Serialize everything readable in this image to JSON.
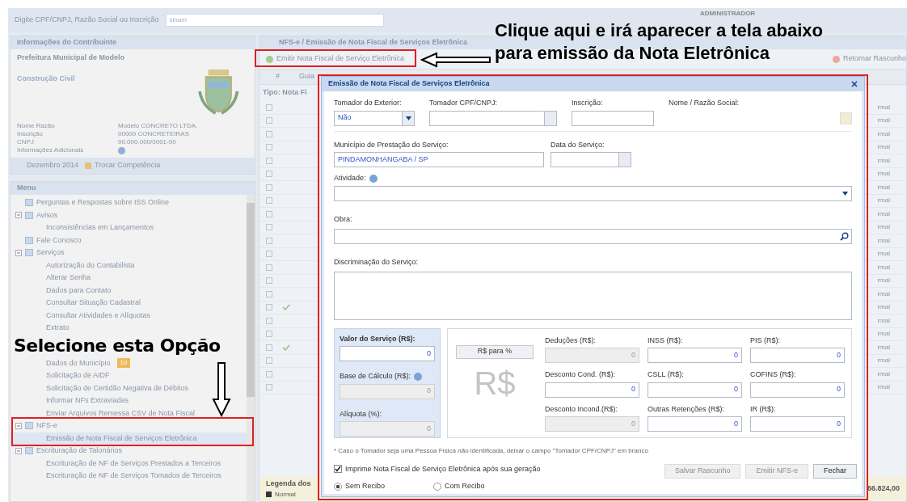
{
  "search": {
    "label": "Digite CPF/CNPJ, Razão Social ou Inscrição",
    "value": "sinam"
  },
  "user": "ADMINISTRADOR",
  "info_panel": {
    "title": "Informações do Contribuinte",
    "org": "Prefeitura Municipal de Modelo",
    "activity": "Construção Civil",
    "fields": [
      {
        "label": "Nome Razão",
        "value": "Modelo CONCRETO LTDA.",
        "kind": "text"
      },
      {
        "label": "Inscrição",
        "value": "00000 CONCRETEIRAS",
        "kind": "text"
      },
      {
        "label": "CNPJ",
        "value": "00.000.000/0001-00",
        "kind": "text"
      },
      {
        "label": "Informações Adicionais",
        "kind": "icon"
      }
    ],
    "period": "Dezembro 2014",
    "change_button": "Trocar Competência"
  },
  "menu": {
    "title": "Menu",
    "items": [
      {
        "kind": "item",
        "label": "Perguntas e Respostas sobre ISS Online",
        "selected": false
      },
      {
        "kind": "item",
        "label": "Avisos",
        "expanded": true,
        "selected": false,
        "children": [
          {
            "kind": "item",
            "label": "Inconsistências em Lançamentos",
            "selected": false
          }
        ]
      },
      {
        "kind": "item",
        "label": "Fale Conosco",
        "selected": false
      },
      {
        "kind": "item",
        "label": "Serviços",
        "expanded": true,
        "selected": false,
        "children": [
          {
            "kind": "item",
            "label": "Autorização do Contabilista",
            "selected": false
          },
          {
            "kind": "item",
            "label": "Alterar Senha",
            "selected": false
          },
          {
            "kind": "item",
            "label": "Dados para Contato",
            "selected": false
          },
          {
            "kind": "item",
            "label": "Consultar Situação Cadastral",
            "selected": false
          },
          {
            "kind": "item",
            "label": "Consultar Atividades e Alíquotas",
            "selected": false
          },
          {
            "kind": "item",
            "label": "Extrato",
            "selected": false
          },
          {
            "kind": "callout",
            "label": "Selecione esta Opção"
          },
          {
            "kind": "item",
            "label": "Dados do Município",
            "badge": "10",
            "selected": false
          },
          {
            "kind": "item",
            "label": "Solicitação de AIDF",
            "selected": false
          },
          {
            "kind": "item",
            "label": "Solicitação de Certidão Negativa de Débitos",
            "selected": false
          },
          {
            "kind": "item",
            "label": "Informar NFs Extraviadas",
            "selected": false
          },
          {
            "kind": "item",
            "label": "Enviar Arquivos Remessa CSV de Nota Fiscal",
            "selected": false
          }
        ]
      },
      {
        "kind": "item",
        "label": "NFS-e",
        "expanded": true,
        "selected": false,
        "children": [
          {
            "kind": "item",
            "label": "Emissão de Nota Fiscal de Serviços Eletrônica",
            "selected": true
          }
        ]
      },
      {
        "kind": "item",
        "label": "Escrituração de Talonários",
        "expanded": true,
        "selected": false,
        "children": [
          {
            "kind": "item",
            "label": "Escrituração de NF de Serviços Prestados a Terceiros",
            "selected": false
          },
          {
            "kind": "item",
            "label": "Escrituração de NF de Serviços Tomados de Terceiros",
            "selected": false
          }
        ]
      }
    ]
  },
  "main": {
    "title": "NFS-e / Emissão de Nota Fiscal de Serviços Eletrônica",
    "emit_button": "Emitir Nota Fiscal de Serviço Eletrônica",
    "draft_button": "Retornar Rascunho",
    "columns": [
      "#",
      "Guia"
    ],
    "group": "Tipo: Nota Fi",
    "rows": [
      {
        "ticked": false,
        "column_end": "rmal"
      },
      {
        "ticked": false,
        "column_end": "rmal"
      },
      {
        "ticked": false,
        "column_end": "rmal"
      },
      {
        "ticked": false,
        "column_end": "rmal"
      },
      {
        "ticked": false,
        "column_end": "rmal"
      },
      {
        "ticked": false,
        "column_end": "rmal"
      },
      {
        "ticked": false,
        "column_end": "rmal"
      },
      {
        "ticked": false,
        "column_end": "rmal"
      },
      {
        "ticked": false,
        "column_end": "rmal"
      },
      {
        "ticked": false,
        "column_end": "rmal"
      },
      {
        "ticked": false,
        "column_end": "rmal"
      },
      {
        "ticked": false,
        "column_end": "rmal"
      },
      {
        "ticked": false,
        "column_end": "rmal"
      },
      {
        "ticked": false,
        "column_end": "rmal"
      },
      {
        "ticked": false,
        "column_end": "rmal"
      },
      {
        "ticked": true,
        "column_end": "rmal"
      },
      {
        "ticked": false,
        "column_end": "rmal"
      },
      {
        "ticked": false,
        "column_end": "rmal"
      },
      {
        "ticked": true,
        "column_end": "rmal"
      },
      {
        "ticked": false,
        "column_end": "rmal"
      },
      {
        "ticked": false,
        "column_end": "rmal"
      },
      {
        "ticked": false,
        "column_end": "rmal"
      }
    ],
    "legend_title": "Legenda dos",
    "legend": [
      {
        "label": "Normal",
        "color": "#333333"
      }
    ],
    "total": "66.824,00"
  },
  "dialog": {
    "title": "Emissão de Nota Fiscal de Serviços Eletrônica",
    "tomador_exterior": {
      "label": "Tomador do Exterior:",
      "value": "Não"
    },
    "tomador_cpf": {
      "label": "Tomador CPF/CNPJ:"
    },
    "inscricao": {
      "label": "Inscrição:"
    },
    "nome": {
      "label": "Nome / Razão Social:"
    },
    "municipio": {
      "label": "Município de Prestação do Serviço:",
      "value": "PINDAMONHANGABA / SP"
    },
    "data": {
      "label": "Data do Serviço:"
    },
    "atividade": {
      "label": "Atividade:"
    },
    "obra": {
      "label": "Obra:"
    },
    "discriminacao": {
      "label": "Discriminação do Serviço:"
    },
    "valor": {
      "label": "Valor do Serviço (R$):",
      "value": "0",
      "disabled": false
    },
    "base": {
      "label": "Base de Cálculo (R$):",
      "value": "0",
      "disabled": true
    },
    "aliquota": {
      "label": "Alíquota (%):",
      "value": "0",
      "disabled": true
    },
    "convert_button": "R$ para %",
    "currency_sign": "R$",
    "amounts": [
      {
        "label": "Deduções (R$):",
        "value": "0",
        "disabled": true
      },
      {
        "label": "INSS (R$):",
        "value": "0",
        "disabled": false
      },
      {
        "label": "PIS (R$):",
        "value": "0",
        "disabled": false
      },
      {
        "label": "Desconto Cond. (R$):",
        "value": "0",
        "disabled": false
      },
      {
        "label": "CSLL (R$):",
        "value": "0",
        "disabled": false
      },
      {
        "label": "COFINS (R$):",
        "value": "0",
        "disabled": false
      },
      {
        "label": "Desconto Incond.(R$):",
        "value": "0",
        "disabled": true
      },
      {
        "label": "Outras Retenções (R$):",
        "value": "0",
        "disabled": false
      },
      {
        "label": "IR (R$):",
        "value": "0",
        "disabled": false
      }
    ],
    "note": "* Caso o Tomador seja uma Pessoa Física não identificada, deixar o campo \"Tomador CPF/CNPJ\" em branco",
    "print_option": {
      "label": "Imprime Nota Fiscal de Serviço Eletrônica após sua geração",
      "checked": true
    },
    "receipt_options": [
      {
        "label": "Sem Recibo",
        "selected": true
      },
      {
        "label": "Com Recibo",
        "selected": false
      }
    ],
    "buttons": [
      {
        "label": "Salvar Rascunho",
        "disabled": true
      },
      {
        "label": "Emitir NFS-e",
        "disabled": true
      },
      {
        "label": "Fechar",
        "disabled": false
      }
    ]
  },
  "annotations": {
    "top": [
      "Clique aqui e irá aparecer a tela abaixo",
      "para emissão da Nota Eletrônica"
    ]
  }
}
